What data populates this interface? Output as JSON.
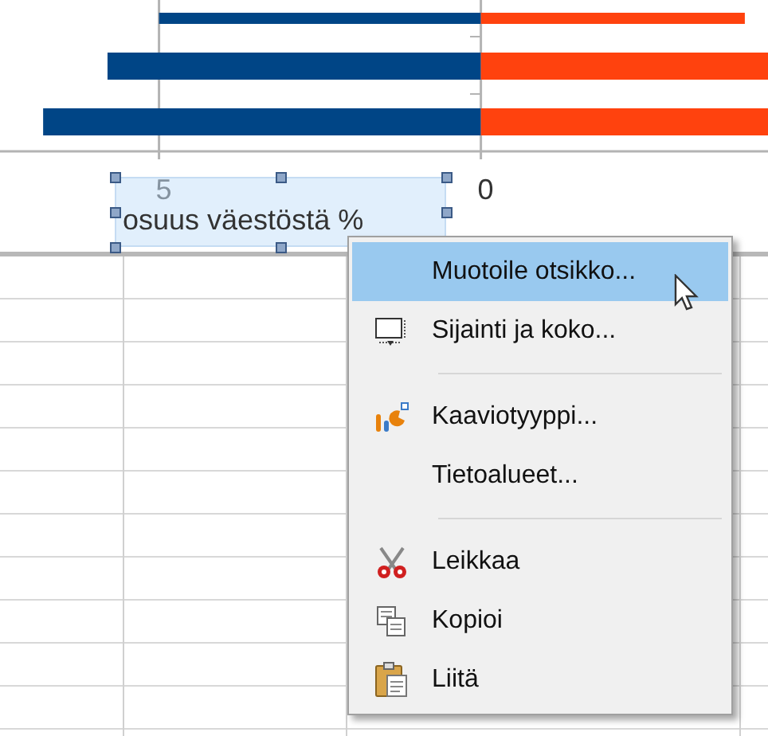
{
  "chart": {
    "chart_data": {
      "type": "bar",
      "orientation": "horizontal",
      "stacked": true,
      "series": [
        {
          "color": "#004586",
          "values": [
            -5.0,
            -5.8,
            -6.8
          ]
        },
        {
          "color": "#ff420e",
          "values": [
            4.1,
            4.46,
            4.46
          ]
        }
      ],
      "xlim": [
        -7.47,
        4.46
      ],
      "xticks": [
        {
          "value": -5,
          "label": "5"
        },
        {
          "value": 0,
          "label": "0"
        }
      ]
    },
    "title": {
      "text": "osuus väestöstä %",
      "selected": true
    }
  },
  "context_menu": {
    "items": [
      {
        "kind": "item",
        "label": "Muotoile otsikko...",
        "selected": true
      },
      {
        "kind": "item",
        "label": "Sijainti ja koko...",
        "selected": false
      },
      {
        "kind": "separator"
      },
      {
        "kind": "item",
        "label": "Kaaviotyyppi...",
        "selected": false
      },
      {
        "kind": "item",
        "label": "Tietoalueet...",
        "selected": false
      },
      {
        "kind": "separator"
      },
      {
        "kind": "item",
        "label": "Leikkaa",
        "selected": false
      },
      {
        "kind": "item",
        "label": "Kopioi",
        "selected": false
      },
      {
        "kind": "item",
        "label": "Liitä",
        "selected": false
      }
    ]
  }
}
